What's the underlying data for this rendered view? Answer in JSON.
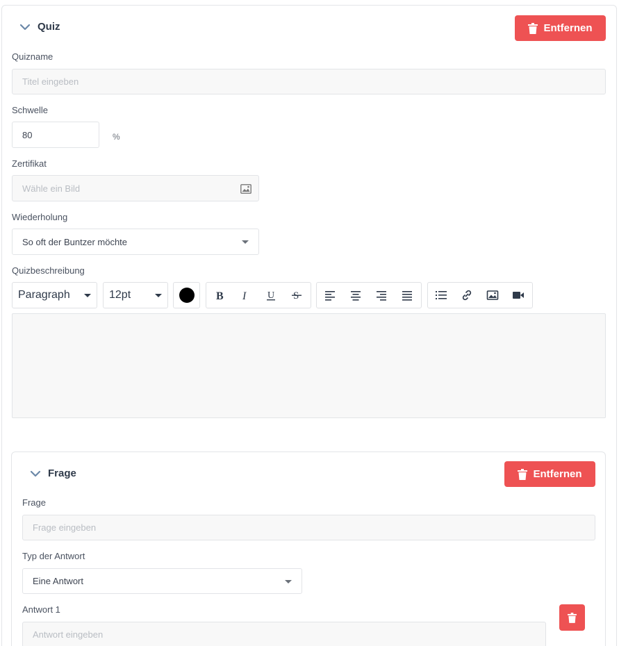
{
  "quiz": {
    "title": "Quiz",
    "remove_label": "Entfernen",
    "name_label": "Quizname",
    "name_placeholder": "Titel eingeben",
    "threshold_label": "Schwelle",
    "threshold_value": "80",
    "threshold_unit": "%",
    "certificate_label": "Zertifikat",
    "certificate_placeholder": "Wähle ein Bild",
    "repeat_label": "Wiederholung",
    "repeat_value": "So oft der Buntzer möchte",
    "description_label": "Quizbeschreibung",
    "toolbar": {
      "block_format": "Paragraph",
      "font_size": "12pt",
      "text_color": "#000000"
    }
  },
  "question": {
    "title": "Frage",
    "remove_label": "Entfernen",
    "question_label": "Frage",
    "question_placeholder": "Frage eingeben",
    "answer_type_label": "Typ der Antwort",
    "answer_type_value": "Eine Antwort",
    "answer1_label": "Antwort 1",
    "answer1_placeholder": "Antwort eingeben"
  },
  "colors": {
    "danger": "#ee5253",
    "field_bg": "#f8f8f8",
    "border": "#e2e4e7"
  }
}
